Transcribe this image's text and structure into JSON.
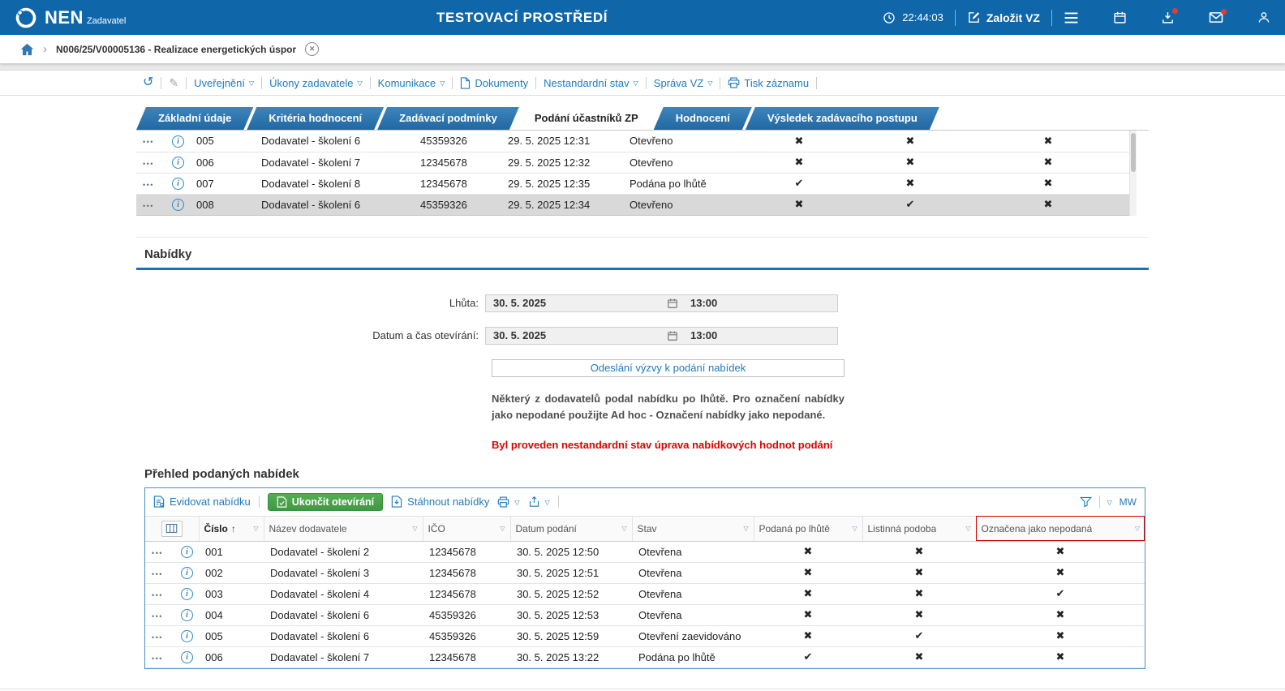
{
  "icons": {
    "dropdown": "▽",
    "cross": "✖",
    "check": "✔",
    "sort_asc": "↑",
    "dots": "•••",
    "pencil": "✎",
    "history": "↺",
    "info": "i",
    "chevron": "›",
    "close": "✕"
  },
  "topbar": {
    "brand": "NEN",
    "brand_sub": "Zadavatel",
    "env_title": "TESTOVACÍ PROSTŘEDÍ",
    "time": "22:44:03",
    "create_vz_label": "Založit VZ"
  },
  "breadcrumb": {
    "record": "N006/25/V00005136 - Realizace energetických úspor"
  },
  "record_toolbar": {
    "links": [
      {
        "label": "Uveřejnění"
      },
      {
        "label": "Úkony zadavatele"
      },
      {
        "label": "Komunikace"
      },
      {
        "label": "Dokumenty"
      },
      {
        "label": "Nestandardní stav"
      },
      {
        "label": "Správa VZ"
      },
      {
        "label": "Tisk záznamu"
      }
    ]
  },
  "tabs": [
    {
      "label": "Základní údaje"
    },
    {
      "label": "Kritéria hodnocení"
    },
    {
      "label": "Zadávací podmínky"
    },
    {
      "label": "Podání účastníků ZP",
      "active": true
    },
    {
      "label": "Hodnocení"
    },
    {
      "label": "Výsledek zadávacího postupu"
    }
  ],
  "participants": {
    "rows": [
      {
        "num": "005",
        "supplier": "Dodavatel - školení 6",
        "ico": "45359326",
        "date": "29. 5. 2025 12:31",
        "status": "Otevřeno",
        "flags": [
          "x",
          "x",
          "x"
        ]
      },
      {
        "num": "006",
        "supplier": "Dodavatel - školení 7",
        "ico": "12345678",
        "date": "29. 5. 2025 12:32",
        "status": "Otevřeno",
        "flags": [
          "x",
          "x",
          "x"
        ]
      },
      {
        "num": "007",
        "supplier": "Dodavatel - školení 8",
        "ico": "12345678",
        "date": "29. 5. 2025 12:35",
        "status": "Podána po lhůtě",
        "flags": [
          "check",
          "x",
          "x"
        ]
      },
      {
        "num": "008",
        "supplier": "Dodavatel - školení 6",
        "ico": "45359326",
        "date": "29. 5. 2025 12:34",
        "status": "Otevřeno",
        "flags": [
          "x",
          "check",
          "x"
        ],
        "selected": true
      }
    ]
  },
  "offers_section": {
    "title": "Nabídky",
    "deadline_label": "Lhůta:",
    "deadline_date": "30. 5. 2025",
    "deadline_time": "13:00",
    "opening_label": "Datum a čas otevírání:",
    "opening_date": "30. 5. 2025",
    "opening_time": "13:00",
    "send_invite_button": "Odeslání výzvy k podání nabídek",
    "note": "Některý z dodavatelů podal nabídku po lhůtě. Pro označení nabídky jako nepodané použijte Ad hoc - Označení nabídky jako nepodané.",
    "warning": "Byl proveden nestandardní stav úprava nabídkových hodnot podání"
  },
  "offers": {
    "title": "Přehled podaných nabídek",
    "toolbar": {
      "register": "Evidovat nabídku",
      "finish_opening": "Ukončit otevírání",
      "download": "Stáhnout nabídky",
      "view_code": "MW"
    },
    "columns": [
      "Číslo",
      "Název dodavatele",
      "IČO",
      "Datum podání",
      "Stav",
      "Podaná po lhůtě",
      "Listinná podoba",
      "Označena jako nepodaná"
    ],
    "rows": [
      {
        "num": "001",
        "supplier": "Dodavatel - školení 2",
        "ico": "12345678",
        "date": "30. 5. 2025 12:50",
        "status": "Otevřena",
        "flags": [
          "x",
          "x",
          "x"
        ]
      },
      {
        "num": "002",
        "supplier": "Dodavatel - školení 3",
        "ico": "12345678",
        "date": "30. 5. 2025 12:51",
        "status": "Otevřena",
        "flags": [
          "x",
          "x",
          "x"
        ]
      },
      {
        "num": "003",
        "supplier": "Dodavatel - školení 4",
        "ico": "12345678",
        "date": "30. 5. 2025 12:52",
        "status": "Otevřena",
        "flags": [
          "x",
          "x",
          "check"
        ]
      },
      {
        "num": "004",
        "supplier": "Dodavatel - školení 6",
        "ico": "45359326",
        "date": "30. 5. 2025 12:53",
        "status": "Otevřena",
        "flags": [
          "x",
          "x",
          "x"
        ]
      },
      {
        "num": "005",
        "supplier": "Dodavatel - školení 6",
        "ico": "45359326",
        "date": "30. 5. 2025 12:59",
        "status": "Otevření zaevidováno",
        "flags": [
          "x",
          "check",
          "x"
        ]
      },
      {
        "num": "006",
        "supplier": "Dodavatel - školení 7",
        "ico": "12345678",
        "date": "30. 5. 2025 13:22",
        "status": "Podána po lhůtě",
        "flags": [
          "check",
          "x",
          "x"
        ]
      }
    ]
  },
  "colors": {
    "header_blue": "#0f67a9",
    "tab_blue": "#2e78b2",
    "link_blue": "#1e7bbf",
    "accent_green": "#46a046",
    "cross_red": "#d9252e",
    "check_green": "#3aa435",
    "warning_red": "#e00000",
    "highlight_red": "#cc0000"
  }
}
